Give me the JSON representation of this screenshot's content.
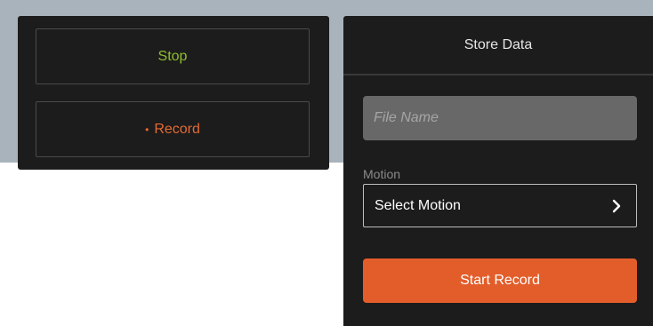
{
  "colors": {
    "accent_orange": "#e35d2a",
    "stop_green": "#8fbf2e",
    "record_orange": "#e46a33",
    "panel_bg": "#1c1c1c",
    "backdrop": "#a9b3bb"
  },
  "controls": {
    "stop_label": "Stop",
    "record_dot": "•",
    "record_label": "Record"
  },
  "store_panel": {
    "title": "Store Data",
    "file_name": {
      "placeholder": "File Name",
      "value": ""
    },
    "motion_label": "Motion",
    "motion_select": {
      "selected": "Select Motion",
      "icon": "chevron-right-icon"
    },
    "start_label": "Start Record"
  }
}
